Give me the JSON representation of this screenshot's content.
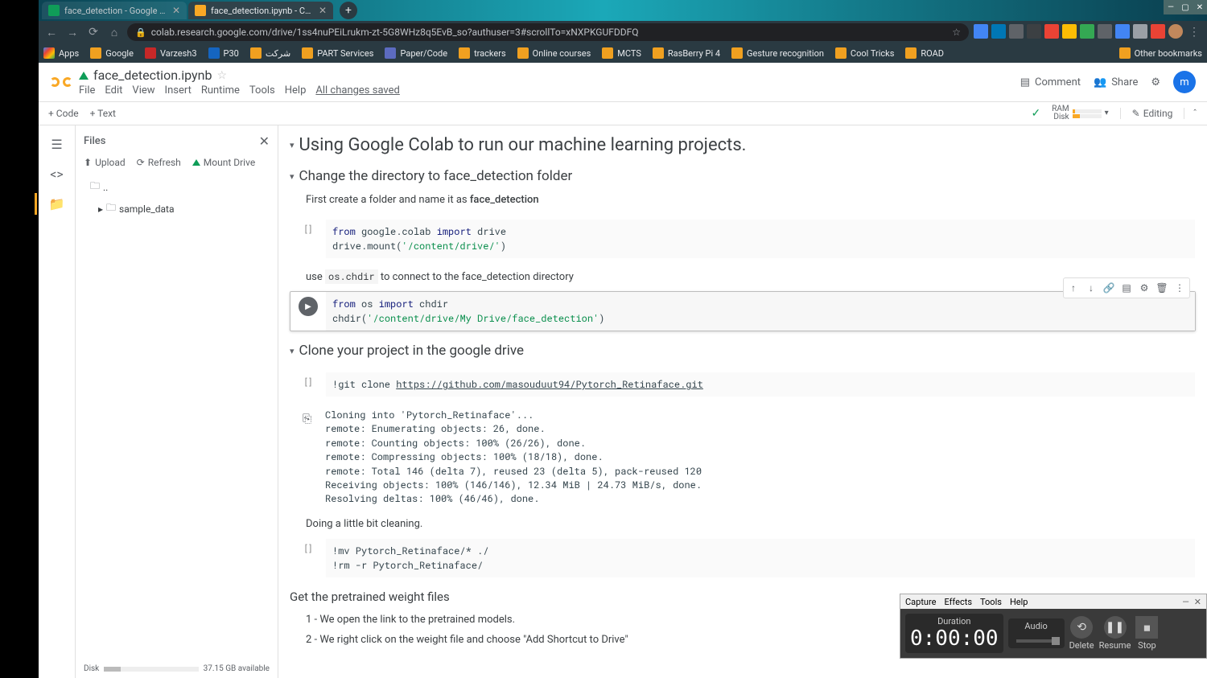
{
  "browser": {
    "tabs": [
      {
        "title": "face_detection - Google Drive",
        "active": false
      },
      {
        "title": "face_detection.ipynb - Colaborat",
        "active": true
      }
    ],
    "url": "colab.research.google.com/drive/1ss4nuPEiLrukm-zt-5G8WHz8q5EvB_so?authuser=3#scrollTo=xNXPKGUFDDFQ"
  },
  "bookmarks": [
    "Apps",
    "Google",
    "Varzesh3",
    "P30",
    "شرکت",
    "PART Services",
    "Paper/Code",
    "trackers",
    "Online courses",
    "MCTS",
    "RasBerry Pi 4",
    "Gesture recognition",
    "Cool Tricks",
    "ROAD"
  ],
  "other_bookmarks": "Other bookmarks",
  "colab": {
    "filename": "face_detection.ipynb",
    "menu": [
      "File",
      "Edit",
      "View",
      "Insert",
      "Runtime",
      "Tools",
      "Help"
    ],
    "saved": "All changes saved",
    "comment": "Comment",
    "share": "Share",
    "avatar": "m",
    "toolbar": {
      "code": "+ Code",
      "text": "+ Text",
      "ram": "RAM",
      "disk": "Disk",
      "editing": "Editing"
    }
  },
  "files": {
    "title": "Files",
    "upload": "Upload",
    "refresh": "Refresh",
    "mount": "Mount Drive",
    "parent": "..",
    "folder": "sample_data",
    "disk_label": "Disk",
    "disk_avail": "37.15 GB available"
  },
  "notebook": {
    "h1": "Using Google Colab to run our machine learning projects.",
    "h2_1": "Change the directory to face_detection folder",
    "p1_pre": "First create a folder and name it as ",
    "p1_bold": "face_detection",
    "code1_l1a": "from",
    "code1_l1b": " google.colab ",
    "code1_l1c": "import",
    "code1_l1d": " drive",
    "code1_l2a": "drive.mount(",
    "code1_l2b": "'/content/drive/'",
    "code1_l2c": ")",
    "p2_pre": "use ",
    "p2_code": "os.chdir",
    "p2_post": " to connect to the face_detection directory",
    "code2_l1a": "from",
    "code2_l1b": " os ",
    "code2_l1c": "import",
    "code2_l1d": " chdir",
    "code2_l2a": "chdir(",
    "code2_l2b": "'/content/drive/My Drive/face_detection'",
    "code2_l2c": ")",
    "h2_2": "Clone your project in the google drive",
    "code3_pre": "!git clone ",
    "code3_url": "https://github.com/masouduut94/Pytorch_Retinaface.git",
    "output3": "Cloning into 'Pytorch_Retinaface'...\nremote: Enumerating objects: 26, done.\nremote: Counting objects: 100% (26/26), done.\nremote: Compressing objects: 100% (18/18), done.\nremote: Total 146 (delta 7), reused 23 (delta 5), pack-reused 120\nReceiving objects: 100% (146/146), 12.34 MiB | 24.73 MiB/s, done.\nResolving deltas: 100% (46/46), done.",
    "p3": "Doing a little bit cleaning.",
    "code4": "!mv Pytorch_Retinaface/* ./\n!rm -r Pytorch_Retinaface/",
    "h3": "Get the pretrained weight files",
    "li1": "1 - We open the link to the pretrained models.",
    "li2": "2 - We right click on the weight file and choose \"Add Shortcut to Drive\""
  },
  "recorder": {
    "menu": [
      "Capture",
      "Effects",
      "Tools",
      "Help"
    ],
    "duration_label": "Duration",
    "duration": "0:00:00",
    "audio_label": "Audio",
    "delete": "Delete",
    "resume": "Resume",
    "stop": "Stop"
  }
}
